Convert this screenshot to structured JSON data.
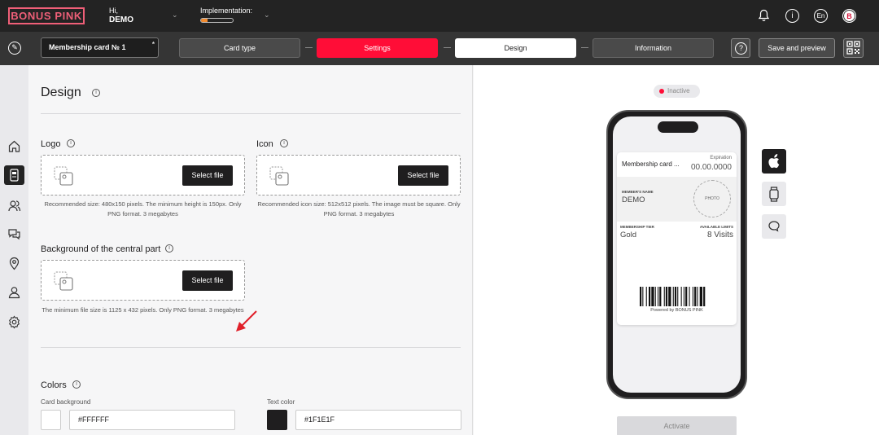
{
  "header": {
    "logo_text": "BONUS PINK",
    "greeting": "Hi,",
    "user_name": "DEMO",
    "implementation_label": "Implementation:",
    "implementation_progress": 0.2,
    "language": "En",
    "avatar_letter": "B",
    "icons": [
      "bell-icon",
      "info-icon",
      "language-icon",
      "avatar"
    ]
  },
  "toolbar": {
    "card_name": "Membership card № 1",
    "steps": [
      {
        "label": "Card type",
        "state": "inactive"
      },
      {
        "label": "Settings",
        "state": "active"
      },
      {
        "label": "Design",
        "state": "current"
      },
      {
        "label": "Information",
        "state": "inactive"
      }
    ],
    "save_label": "Save and preview"
  },
  "sidebar": {
    "items": [
      "home-icon",
      "card-icon",
      "users-icon",
      "chat-icon",
      "location-icon",
      "user-icon",
      "settings-icon"
    ],
    "active_index": 1
  },
  "design": {
    "title": "Design",
    "logo": {
      "label": "Logo",
      "button": "Select file",
      "hint_line1": "Recommended size: 480x150 pixels. The minimum height is 150px. Only",
      "hint_line2": "PNG format. 3 megabytes"
    },
    "icon": {
      "label": "Icon",
      "button": "Select file",
      "hint_line1": "Recommended icon size: 512x512 pixels. The image must be square. Only",
      "hint_line2": "PNG format. 3 megabytes"
    },
    "background": {
      "label": "Background of the central part",
      "button": "Select file",
      "hint": "The minimum file size is 1125 x 432 pixels. Only PNG format. 3 megabytes"
    },
    "colors": {
      "title": "Colors",
      "card_background_label": "Card background",
      "card_background_value": "#FFFFFF",
      "text_color_label": "Text color",
      "text_color_value": "#1F1E1F"
    }
  },
  "preview": {
    "status": "Inactive",
    "pass": {
      "name": "Membership card ...",
      "expiration_label": "Expiration",
      "expiration_value": "00.00.0000",
      "member_label": "MEMBER'S NAME",
      "member_value": "DEMO",
      "photo_label": "PHOTO",
      "tier_label": "MEMBERSHIP TIER",
      "tier_value": "Gold",
      "limits_label": "AVAILABLE LIMITS",
      "limits_value": "8 Visits",
      "powered_by": "Powered by BONUS PINK"
    },
    "platform_buttons": [
      "apple-icon",
      "watch-icon",
      "message-icon"
    ],
    "activate_label": "Activate"
  },
  "colors": {
    "accent": "#FF0D37",
    "brand": "#EF5F78",
    "dark": "#232323",
    "progress": "#F28B2F"
  }
}
